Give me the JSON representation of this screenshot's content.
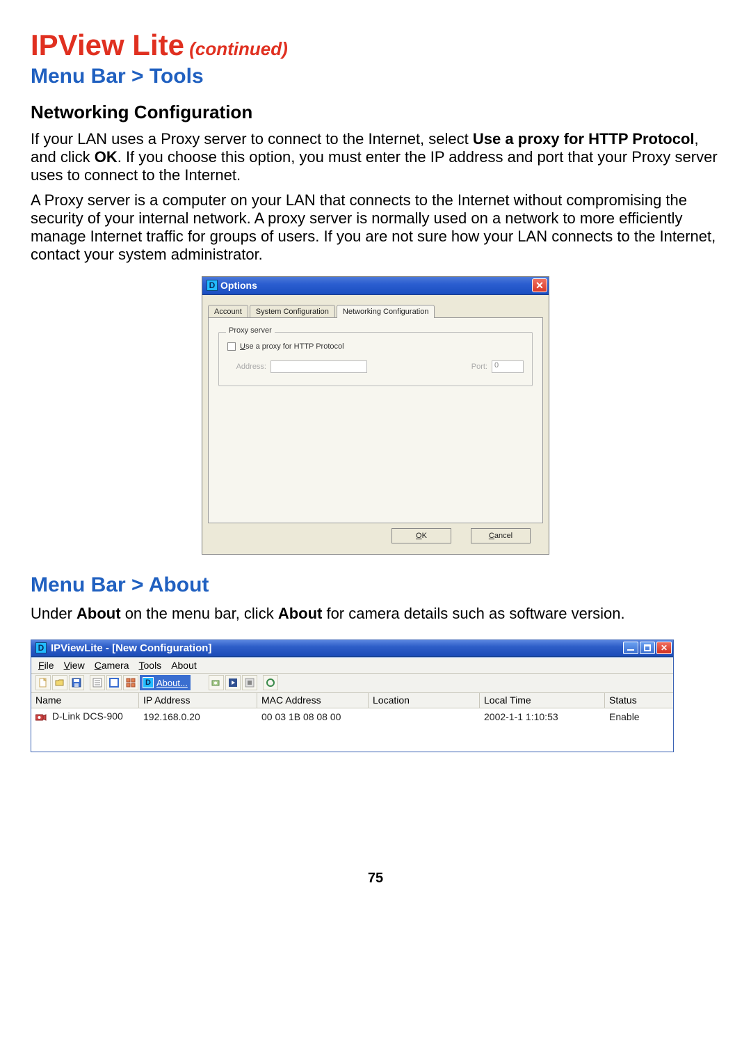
{
  "page": {
    "title_main": "IPView Lite",
    "title_cont": " (continued)",
    "section1": "Menu Bar > Tools",
    "subsection1": "Networking Configuration",
    "para1a": "If your LAN uses a Proxy server to connect to the Internet, select ",
    "para1b_bold": "Use a proxy for HTTP Protocol",
    "para1c": ", and click ",
    "para1d_bold": "OK",
    "para1e": ". If you choose this option, you must enter the IP address and port that your Proxy server uses to connect to the Internet.",
    "para2": "A Proxy server is a computer on your LAN that connects to the Internet without compromising the security of your internal network.  A proxy server is normally used on a network to more efficiently manage Internet traffic for groups of users.  If you are not sure how your LAN connects to the Internet, contact your system administrator.",
    "section2": "Menu Bar > About",
    "para3a": "Under ",
    "para3b_bold": "About",
    "para3c": " on the menu bar, click ",
    "para3d_bold": "About",
    "para3e": " for camera details such as software version.",
    "page_number": "75"
  },
  "options": {
    "icon_letter": "D",
    "title": "Options",
    "close_glyph": "✕",
    "tabs": {
      "t0": "Account",
      "t1": "System Configuration",
      "t2": "Networking Configuration"
    },
    "group_title": "Proxy server",
    "chk_u_letter": "U",
    "chk_rest": "se a proxy for HTTP Protocol",
    "address_label": "Address:",
    "address_value": "",
    "port_p_letter": "P",
    "port_rest": "ort:",
    "port_value": "0",
    "ok_o": "O",
    "ok_rest": "K",
    "cancel_c": "C",
    "cancel_rest": "ancel"
  },
  "ipview": {
    "icon_letter": "D",
    "title": "IPViewLite - [New Configuration]",
    "close_glyph": "✕",
    "menus": {
      "file_u": "F",
      "file_r": "ile",
      "view_u": "V",
      "view_r": "iew",
      "camera_u": "C",
      "camera_r": "amera",
      "tools_u": "T",
      "tools_r": "ools",
      "about": "About"
    },
    "about_menu": {
      "icon_letter": "D",
      "label": "About..."
    },
    "cols": {
      "name": "Name",
      "ip": "IP Address",
      "mac": "MAC Address",
      "loc": "Location",
      "time": "Local Time",
      "status": "Status"
    },
    "row": {
      "name": "D-Link DCS-900",
      "ip": "192.168.0.20",
      "mac": "00 03 1B 08 08 00",
      "loc": "",
      "time": "2002-1-1  1:10:53",
      "status": "Enable"
    }
  }
}
